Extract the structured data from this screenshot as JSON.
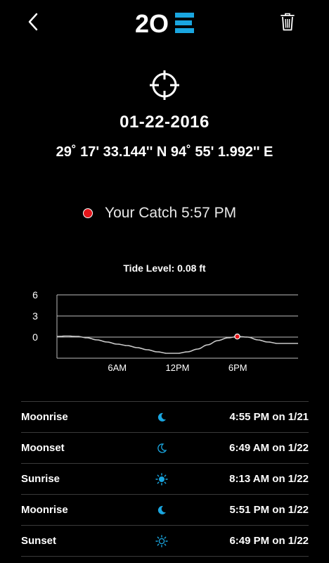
{
  "header": {
    "back_icon": "chevron-left-icon",
    "logo_text_a": "2O",
    "logo_text_b": "E",
    "trash_icon": "trash-icon",
    "accent_color": "#1aa6e0"
  },
  "target_icon": "crosshair-icon",
  "date": "01-22-2016",
  "coordinates": "29˚ 17' 33.144'' N  94˚ 55' 1.992'' E",
  "catch": {
    "label": "Your Catch 5:57 PM",
    "marker_color": "#e3151a"
  },
  "tide": {
    "label": "Tide Level: 0.08 ft"
  },
  "chart_data": {
    "type": "line",
    "y_ticks": [
      "6",
      "3",
      "0"
    ],
    "x_ticks": [
      "6AM",
      "12PM",
      "6PM"
    ],
    "ylim": [
      -3,
      6
    ],
    "xlim": [
      0,
      24
    ],
    "series": [
      {
        "x": [
          0,
          1,
          2,
          3,
          4,
          5,
          6,
          7,
          8,
          9,
          10,
          11,
          12,
          13,
          14,
          15,
          16,
          17,
          18,
          19,
          20,
          21,
          22,
          23,
          24
        ],
        "y": [
          0.1,
          0.15,
          0.1,
          -0.1,
          -0.4,
          -0.7,
          -1.0,
          -1.2,
          -1.5,
          -1.8,
          -2.1,
          -2.3,
          -2.3,
          -2.1,
          -1.7,
          -1.1,
          -0.5,
          -0.1,
          0.08,
          0.0,
          -0.4,
          -0.7,
          -0.9,
          -0.9,
          -0.9
        ]
      }
    ],
    "marker": {
      "x": 17.95,
      "y": 0.08
    }
  },
  "events": [
    {
      "name": "Moonrise",
      "icon": "moon-filled-icon",
      "time": "4:55 PM on 1/21"
    },
    {
      "name": "Moonset",
      "icon": "moon-outline-icon",
      "time": "6:49 AM on 1/22"
    },
    {
      "name": "Sunrise",
      "icon": "sun-filled-icon",
      "time": "8:13 AM on 1/22"
    },
    {
      "name": "Moonrise",
      "icon": "moon-filled-icon",
      "time": "5:51 PM on 1/22"
    },
    {
      "name": "Sunset",
      "icon": "sun-outline-icon",
      "time": "6:49 PM on 1/22"
    }
  ]
}
